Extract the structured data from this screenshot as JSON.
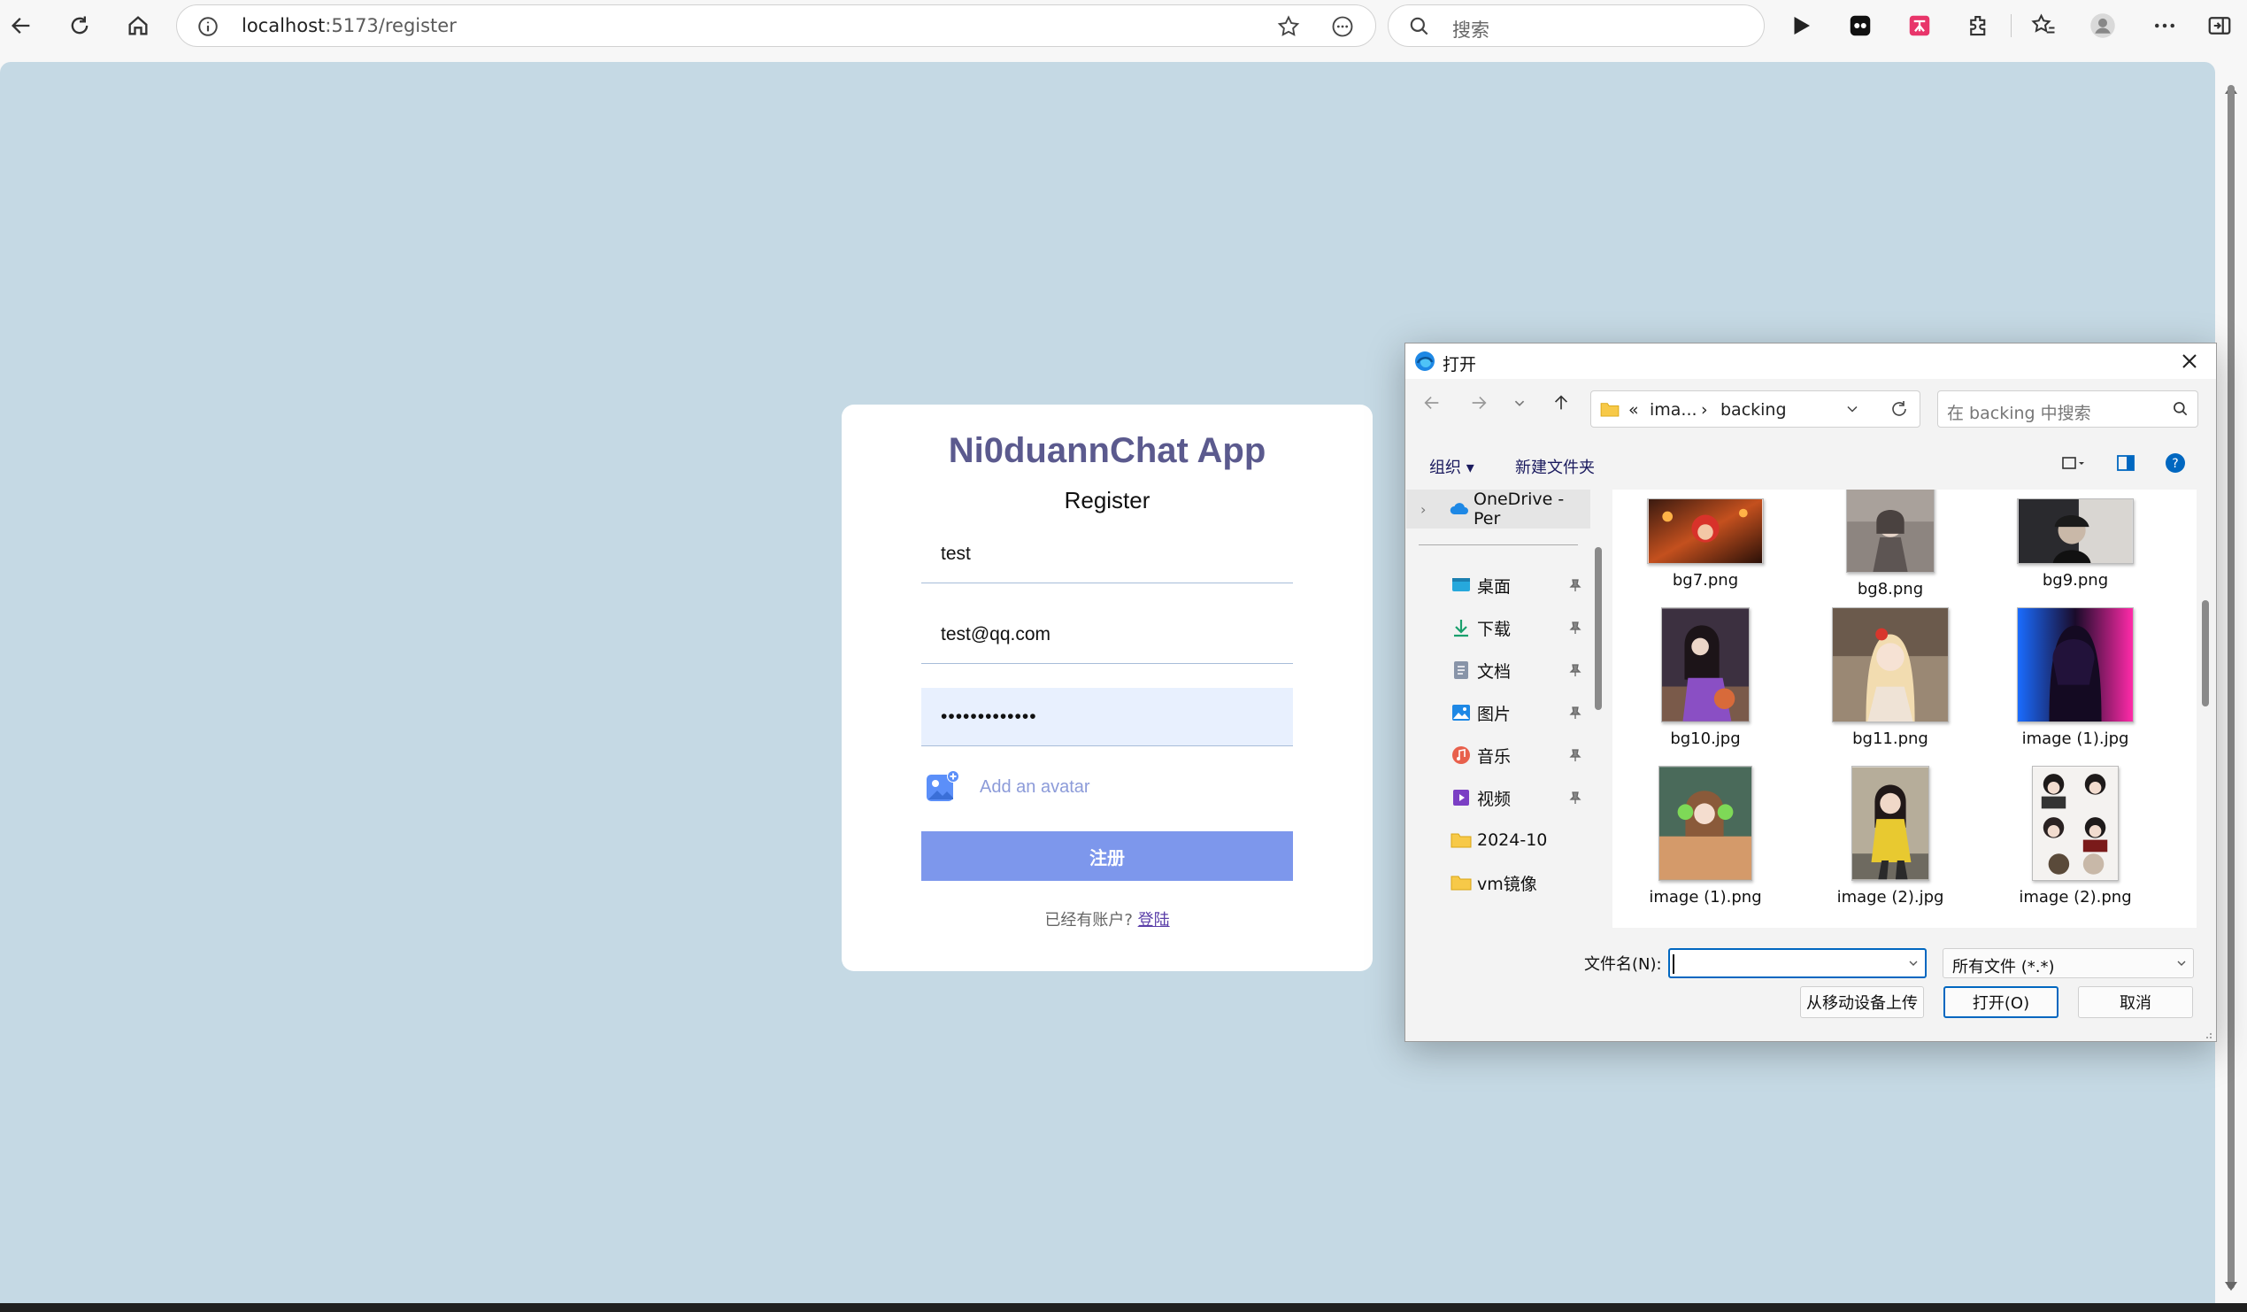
{
  "browser": {
    "url_host": "localhost",
    "url_path": ":5173/register",
    "search_placeholder": "搜索"
  },
  "card": {
    "title": "Ni0duannChat App",
    "subtitle": "Register",
    "username_value": "test",
    "email_value": "test@qq.com",
    "password_value": "•••••••••••••",
    "avatar_label": "Add an avatar",
    "submit_label": "注册",
    "login_prompt": "已经有账户?",
    "login_link": "登陆"
  },
  "dialog": {
    "title": "打开",
    "breadcrumb_prefix": "«",
    "breadcrumb_parent": "ima...",
    "breadcrumb_sep": "›",
    "breadcrumb_current": "backing",
    "search_placeholder": "在 backing 中搜索",
    "organize_label": "组织 ▾",
    "new_folder_label": "新建文件夹",
    "tree": [
      {
        "label": "OneDrive - Per",
        "icon": "cloud-icon",
        "pinned": false
      },
      {
        "label": "桌面",
        "icon": "desktop-icon",
        "pinned": true
      },
      {
        "label": "下载",
        "icon": "download-icon",
        "pinned": true
      },
      {
        "label": "文档",
        "icon": "document-icon",
        "pinned": true
      },
      {
        "label": "图片",
        "icon": "pictures-icon",
        "pinned": true
      },
      {
        "label": "音乐",
        "icon": "music-icon",
        "pinned": true
      },
      {
        "label": "视频",
        "icon": "video-icon",
        "pinned": true
      },
      {
        "label": "2024-10",
        "icon": "folder-icon",
        "pinned": false
      },
      {
        "label": "vm镜像",
        "icon": "folder-icon",
        "pinned": false
      }
    ],
    "files": [
      {
        "name": "bg7.png"
      },
      {
        "name": "bg8.png"
      },
      {
        "name": "bg9.png"
      },
      {
        "name": "bg10.jpg"
      },
      {
        "name": "bg11.png"
      },
      {
        "name": "image (1).jpg"
      },
      {
        "name": "image (1).png"
      },
      {
        "name": "image (2).jpg"
      },
      {
        "name": "image (2).png"
      }
    ],
    "filename_label": "文件名(N):",
    "filename_value": "",
    "filetype_value": "所有文件 (*.*)",
    "upload_button": "从移动设备上传",
    "open_button": "打开(O)",
    "cancel_button": "取消"
  },
  "colors": {
    "page_bg": "#c5d9e4",
    "title_color": "#5b5a8e",
    "submit_bg": "#7d97ec",
    "dialog_accent": "#0067c0"
  }
}
